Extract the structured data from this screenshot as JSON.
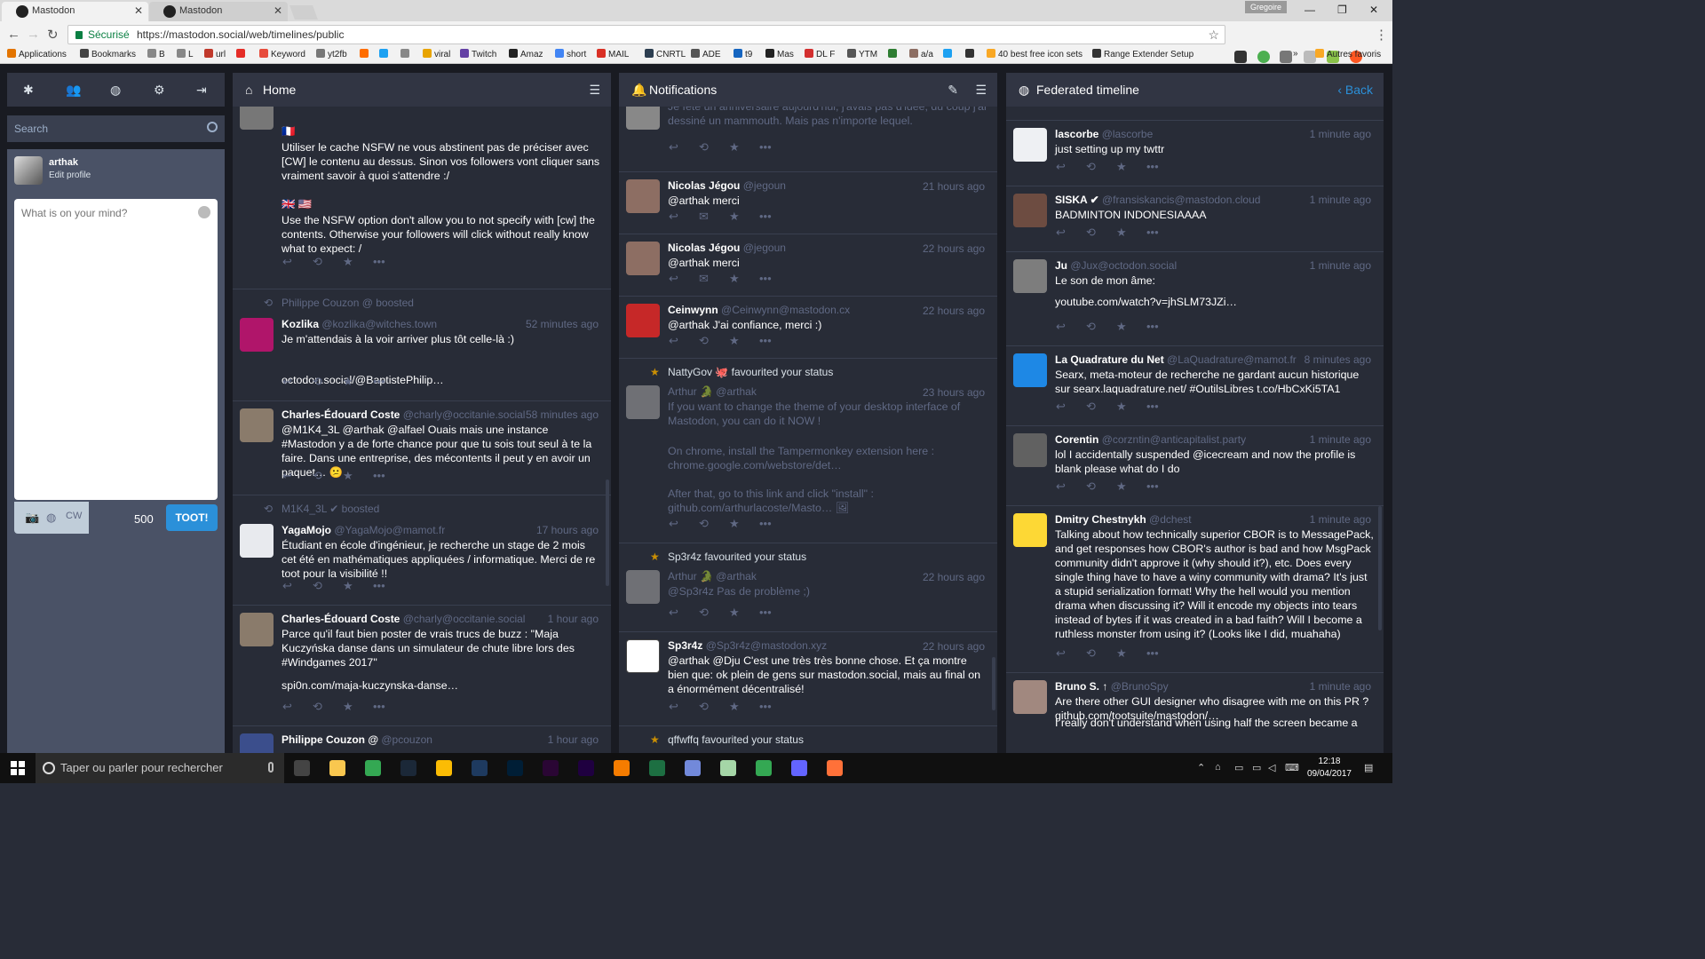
{
  "browser": {
    "tabs": [
      {
        "label": "Mastodon"
      },
      {
        "label": "Mastodon"
      }
    ],
    "user_badge": "Gregoire",
    "secure_label": "Sécurisé",
    "url": "https://mastodon.social/web/timelines/public",
    "bookmarks": [
      {
        "label": "Applications",
        "color": "#e37400"
      },
      {
        "label": "Bookmarks",
        "color": "#444444"
      },
      {
        "label": "B",
        "color": "#888888"
      },
      {
        "label": "L",
        "color": "#888888"
      },
      {
        "label": "url",
        "color": "#c0392b"
      },
      {
        "label": "",
        "color": "#e52d27"
      },
      {
        "label": "Keyword",
        "color": "#e74c3c"
      },
      {
        "label": "yt2fb",
        "color": "#777777"
      },
      {
        "label": "",
        "color": "#ff6d00"
      },
      {
        "label": "",
        "color": "#1da1f2"
      },
      {
        "label": "",
        "color": "#888888"
      },
      {
        "label": "viral",
        "color": "#e8a400"
      },
      {
        "label": "Twitch",
        "color": "#6441a5"
      },
      {
        "label": "Amaz",
        "color": "#222222"
      },
      {
        "label": "short",
        "color": "#4285f4"
      },
      {
        "label": "MAIL",
        "color": "#d93025"
      },
      {
        "label": "CNRTL",
        "color": "#2c3e50"
      },
      {
        "label": "ADE",
        "color": "#555555"
      },
      {
        "label": "t9",
        "color": "#1565c0"
      },
      {
        "label": "Mas",
        "color": "#222222"
      },
      {
        "label": "DL F",
        "color": "#d32f2f"
      },
      {
        "label": "YTM",
        "color": "#555555"
      },
      {
        "label": "",
        "color": "#2e7d32"
      },
      {
        "label": "a/a",
        "color": "#8d6e63"
      },
      {
        "label": "",
        "color": "#1da1f2"
      },
      {
        "label": "",
        "color": "#333333"
      },
      {
        "label": "40 best free icon sets",
        "color": "#f9a825"
      },
      {
        "label": "Range Extender Setup",
        "color": "#333333"
      },
      {
        "label": "Autres favoris",
        "color": "#f9a825"
      }
    ]
  },
  "drawer": {
    "search_placeholder": "Search",
    "me": {
      "name": "arthak",
      "edit": "Edit profile"
    },
    "compose_placeholder": "What is on your mind?",
    "cw_label": "CW",
    "char_count": "500",
    "toot_label": "TOOT!"
  },
  "home": {
    "title": "Home",
    "statuses": [
      {
        "name": "",
        "handle": "",
        "time": "",
        "flags": "🇫🇷",
        "text": "Utiliser le cache NSFW ne vous abstinent pas de préciser avec [CW] le contenu au dessus. Sinon vos followers vont cliquer sans vraiment savoir à quoi s'attendre :/",
        "flags2": "🇬🇧 🇺🇸",
        "text2": "Use the NSFW option don't allow you to not specify with [cw] the contents. Otherwise your followers will click without really know what to expect: /"
      },
      {
        "boost": "Philippe Couzon @ boosted",
        "name": "Kozlika",
        "handle": "@kozlika@witches.town",
        "time": "52 minutes ago",
        "text": "Je m'attendais à la voir arriver plus tôt celle-là :)",
        "text2": "octodon.social/@BaptistePhilip…",
        "color": "#b0156a"
      },
      {
        "name": "Charles-Édouard Coste",
        "handle": "@charly@occitanie.social",
        "time": "58 minutes ago",
        "text": "@M1K4_3L @arthak @alfael Ouais mais une instance #Mastodon y a de forte chance pour que tu sois tout seul à te la faire. Dans une entreprise, des mécontents il peut y en avoir un paquet… 😕",
        "color": "#8a7b6b"
      },
      {
        "boost": "M1K4_3L ✔ boosted",
        "name": "YagaMojo",
        "handle": "@YagaMojo@mamot.fr",
        "time": "17 hours ago",
        "text": "Étudiant en école d'ingénieur, je recherche un stage de 2 mois cet été en mathématiques appliquées / informatique. Merci de re toot pour la visibilité !!",
        "color": "#e8eaee"
      },
      {
        "name": "Charles-Édouard Coste",
        "handle": "@charly@occitanie.social",
        "time": "1 hour ago",
        "text": "Parce qu'il faut bien poster de vrais trucs de buzz : \"Maja Kuczyńska danse dans un simulateur de chute libre lors des #Windgames 2017\"",
        "text2": "spi0n.com/maja-kuczynska-danse…",
        "color": "#8a7b6b"
      },
      {
        "name": "Philippe Couzon @",
        "handle": "@pcouzon",
        "time": "1 hour ago",
        "text": "",
        "color": "#3b4e8c"
      }
    ]
  },
  "notifications": {
    "title": "Notifications",
    "items": [
      {
        "kind": "status-muted",
        "text": "Je fête un anniversaire aujourd'hui, j'avais pas d'idée, du coup j'ai dessiné un mammouth. Mais pas n'importe lequel."
      },
      {
        "name": "Nicolas Jégou",
        "handle": "@jegoun",
        "time": "21 hours ago",
        "text": "@arthak merci",
        "color": "#8d6e63"
      },
      {
        "name": "Nicolas Jégou",
        "handle": "@jegoun",
        "time": "22 hours ago",
        "text": "@arthak merci",
        "color": "#8d6e63"
      },
      {
        "name": "Ceinwynn",
        "handle": "@Ceinwynn@mastodon.cx",
        "time": "22 hours ago",
        "text": "@arthak J'ai confiance, merci :)",
        "color": "#c62828"
      },
      {
        "fav": "NattyGov 🐙 favourited your status",
        "name": "Arthur 🐊",
        "handle": "@arthak",
        "time": "23 hours ago",
        "text": "If you want to change the theme of your desktop interface of Mastodon, you can do it NOW !",
        "text2": "On chrome, install the Tampermonkey extension here : chrome.google.com/webstore/det…",
        "text3": "After that, go to this link and click \"install\" : github.com/arthurlacoste/Masto… 🖼",
        "color": "#9e9e9e"
      },
      {
        "fav": "Sp3r4z favourited your status",
        "name": "Arthur 🐊",
        "handle": "@arthak",
        "time": "22 hours ago",
        "text": "@Sp3r4z Pas de problème ;)",
        "color": "#9e9e9e"
      },
      {
        "name": "Sp3r4z",
        "handle": "@Sp3r4z@mastodon.xyz",
        "time": "22 hours ago",
        "text": "@arthak @Dju C'est une très très bonne chose. Et ça montre bien que: ok plein de gens sur mastodon.social, mais au final on a énormément décentralisé!",
        "color": "#ffffff"
      },
      {
        "fav": "qffwffq favourited your status"
      }
    ]
  },
  "federated": {
    "title": "Federated timeline",
    "back_label": "Back",
    "statuses": [
      {
        "name": "lascorbe",
        "handle": "@lascorbe",
        "time": "1 minute ago",
        "text": "just setting up my twttr",
        "color": "#eef0f3"
      },
      {
        "name": "SISKA ✔",
        "handle": "@fransiskancis@mastodon.cloud",
        "time": "1 minute ago",
        "text": "BADMINTON INDONESIAAAA",
        "color": "#6d4c41"
      },
      {
        "name": "Ju",
        "handle": "@Jux@octodon.social",
        "time": "1 minute ago",
        "text": "Le son de mon âme:",
        "text2": "youtube.com/watch?v=jhSLM73JZi…",
        "color": "#7d7d7d"
      },
      {
        "name": "La Quadrature du Net",
        "handle": "@LaQuadrature@mamot.fr",
        "time": "8 minutes ago",
        "text": "Searx, meta-moteur de recherche ne gardant aucun historique sur searx.laquadrature.net/ #OutilsLibres t.co/HbCxKi5TA1",
        "color": "#1e88e5"
      },
      {
        "name": "Corentin",
        "handle": "@corzntin@anticapitalist.party",
        "time": "1 minute ago",
        "text": "lol I accidentally suspended @icecream and now the profile is blank please what do I do",
        "color": "#616161"
      },
      {
        "name": "Dmitry Chestnykh",
        "handle": "@dchest",
        "time": "1 minute ago",
        "text": "Talking about how technically superior CBOR is to MessagePack, and get responses how CBOR's author is bad and how MsgPack community didn't approve it (why should it?), etc. Does every single thing have to have a winy community with drama? It's just a stupid serialization format! Why the hell would you mention drama when discussing it? Will it encode my objects into tears instead of bytes if it was created in a bad faith? Will I become a ruthless monster from using it? (Looks like I did, muahaha)",
        "color": "#fdd835"
      },
      {
        "name": "Bruno S. ↑",
        "handle": "@BrunoSpy",
        "time": "1 minute ago",
        "text": "Are there other GUI designer who disagree with me on this PR ? github.com/tootsuite/mastodon/…",
        "text2": "I really don't understand when using half the screen became a",
        "color": "#a1887f"
      }
    ]
  },
  "taskbar": {
    "search_placeholder": "Taper ou parler pour rechercher",
    "time": "12:18",
    "date": "09/04/2017",
    "apps": [
      {
        "name": "task-view",
        "color": "#444444"
      },
      {
        "name": "explorer",
        "color": "#f9c74f"
      },
      {
        "name": "chrome",
        "color": "#34a853"
      },
      {
        "name": "steam",
        "color": "#1b2838"
      },
      {
        "name": "keep",
        "color": "#fbbc04"
      },
      {
        "name": "media",
        "color": "#1e3a5f"
      },
      {
        "name": "photoshop",
        "color": "#001e36"
      },
      {
        "name": "premiere",
        "color": "#2a0634"
      },
      {
        "name": "after-effects",
        "color": "#1f0040"
      },
      {
        "name": "vlc",
        "color": "#f57c00"
      },
      {
        "name": "excel",
        "color": "#1d6f42"
      },
      {
        "name": "discord",
        "color": "#7289da"
      },
      {
        "name": "app",
        "color": "#a5d6a7"
      },
      {
        "name": "chrome-active",
        "color": "#34a853"
      },
      {
        "name": "mastodon",
        "color": "#6364ff"
      },
      {
        "name": "firefox",
        "color": "#ff7139"
      }
    ]
  }
}
